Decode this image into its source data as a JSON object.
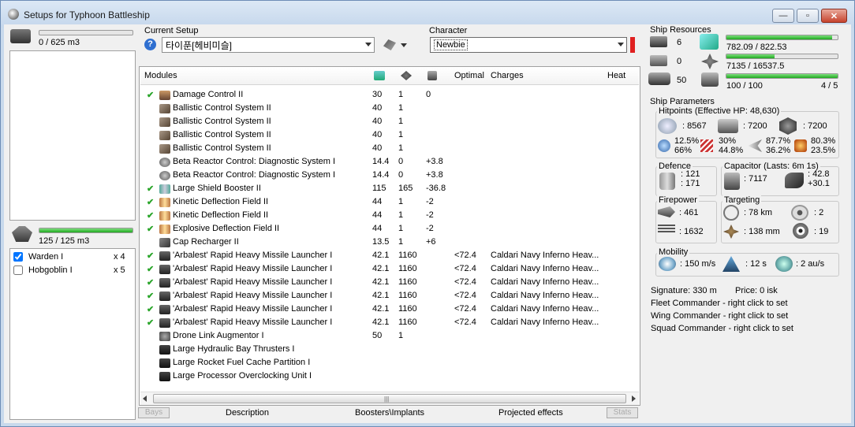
{
  "window": {
    "title": "Setups for Typhoon Battleship",
    "minimize": "—",
    "maximize": "▫",
    "close": "✕"
  },
  "cargo": {
    "text": "0 / 625 m3",
    "fraction": 0.0
  },
  "drones": {
    "bandwidth_text": "125 / 125 m3",
    "fraction": 1.0,
    "items": [
      {
        "name": "Warden I",
        "qty": "x 4",
        "checked": true
      },
      {
        "name": "Hobgoblin I",
        "qty": "x 5",
        "checked": false
      }
    ]
  },
  "setup": {
    "label": "Current Setup",
    "value": "타이푼[헤비미슬]"
  },
  "character": {
    "label": "Character",
    "value": "Newbie"
  },
  "modules": {
    "headers": {
      "name": "Modules",
      "optimal": "Optimal",
      "charges": "Charges",
      "heat": "Heat"
    },
    "rows": [
      {
        "check": true,
        "name": "Damage Control II",
        "cpu": "30",
        "pg": "1",
        "cap": "0",
        "optimal": "",
        "charges": "",
        "icon": "damage-control-icon"
      },
      {
        "check": false,
        "name": "Ballistic Control System II",
        "cpu": "40",
        "pg": "1",
        "cap": "",
        "optimal": "",
        "charges": "",
        "icon": "ballistic-control-icon"
      },
      {
        "check": false,
        "name": "Ballistic Control System II",
        "cpu": "40",
        "pg": "1",
        "cap": "",
        "optimal": "",
        "charges": "",
        "icon": "ballistic-control-icon"
      },
      {
        "check": false,
        "name": "Ballistic Control System II",
        "cpu": "40",
        "pg": "1",
        "cap": "",
        "optimal": "",
        "charges": "",
        "icon": "ballistic-control-icon"
      },
      {
        "check": false,
        "name": "Ballistic Control System II",
        "cpu": "40",
        "pg": "1",
        "cap": "",
        "optimal": "",
        "charges": "",
        "icon": "ballistic-control-icon"
      },
      {
        "check": false,
        "name": "Beta Reactor Control: Diagnostic System I",
        "cpu": "14.4",
        "pg": "0",
        "cap": "+3.8",
        "optimal": "",
        "charges": "",
        "icon": "reactor-control-icon"
      },
      {
        "check": false,
        "name": "Beta Reactor Control: Diagnostic System I",
        "cpu": "14.4",
        "pg": "0",
        "cap": "+3.8",
        "optimal": "",
        "charges": "",
        "icon": "reactor-control-icon"
      },
      {
        "check": true,
        "name": "Large Shield Booster II",
        "cpu": "115",
        "pg": "165",
        "cap": "-36.8",
        "optimal": "",
        "charges": "",
        "icon": "shield-booster-icon"
      },
      {
        "check": true,
        "name": "Kinetic Deflection Field II",
        "cpu": "44",
        "pg": "1",
        "cap": "-2",
        "optimal": "",
        "charges": "",
        "icon": "deflection-field-icon"
      },
      {
        "check": true,
        "name": "Kinetic Deflection Field II",
        "cpu": "44",
        "pg": "1",
        "cap": "-2",
        "optimal": "",
        "charges": "",
        "icon": "deflection-field-icon"
      },
      {
        "check": true,
        "name": "Explosive Deflection Field II",
        "cpu": "44",
        "pg": "1",
        "cap": "-2",
        "optimal": "",
        "charges": "",
        "icon": "deflection-field-icon"
      },
      {
        "check": false,
        "name": "Cap Recharger II",
        "cpu": "13.5",
        "pg": "1",
        "cap": "+6",
        "optimal": "",
        "charges": "",
        "icon": "cap-recharger-icon"
      },
      {
        "check": true,
        "name": "'Arbalest' Rapid Heavy Missile Launcher I",
        "cpu": "42.1",
        "pg": "1160",
        "cap": "",
        "optimal": "<72.4",
        "charges": "Caldari Navy Inferno Heav...",
        "icon": "missile-launcher-icon"
      },
      {
        "check": true,
        "name": "'Arbalest' Rapid Heavy Missile Launcher I",
        "cpu": "42.1",
        "pg": "1160",
        "cap": "",
        "optimal": "<72.4",
        "charges": "Caldari Navy Inferno Heav...",
        "icon": "missile-launcher-icon"
      },
      {
        "check": true,
        "name": "'Arbalest' Rapid Heavy Missile Launcher I",
        "cpu": "42.1",
        "pg": "1160",
        "cap": "",
        "optimal": "<72.4",
        "charges": "Caldari Navy Inferno Heav...",
        "icon": "missile-launcher-icon"
      },
      {
        "check": true,
        "name": "'Arbalest' Rapid Heavy Missile Launcher I",
        "cpu": "42.1",
        "pg": "1160",
        "cap": "",
        "optimal": "<72.4",
        "charges": "Caldari Navy Inferno Heav...",
        "icon": "missile-launcher-icon"
      },
      {
        "check": true,
        "name": "'Arbalest' Rapid Heavy Missile Launcher I",
        "cpu": "42.1",
        "pg": "1160",
        "cap": "",
        "optimal": "<72.4",
        "charges": "Caldari Navy Inferno Heav...",
        "icon": "missile-launcher-icon"
      },
      {
        "check": true,
        "name": "'Arbalest' Rapid Heavy Missile Launcher I",
        "cpu": "42.1",
        "pg": "1160",
        "cap": "",
        "optimal": "<72.4",
        "charges": "Caldari Navy Inferno Heav...",
        "icon": "missile-launcher-icon"
      },
      {
        "check": false,
        "name": "Drone Link Augmentor I",
        "cpu": "50",
        "pg": "1",
        "cap": "",
        "optimal": "",
        "charges": "",
        "icon": "drone-link-icon"
      },
      {
        "check": false,
        "name": "Large Hydraulic Bay Thrusters I",
        "cpu": "",
        "pg": "",
        "cap": "",
        "optimal": "",
        "charges": "",
        "icon": "rig-icon"
      },
      {
        "check": false,
        "name": "Large Rocket Fuel Cache Partition I",
        "cpu": "",
        "pg": "",
        "cap": "",
        "optimal": "",
        "charges": "",
        "icon": "rig-icon"
      },
      {
        "check": false,
        "name": "Large Processor Overclocking Unit I",
        "cpu": "",
        "pg": "",
        "cap": "",
        "optimal": "",
        "charges": "",
        "icon": "rig-icon"
      }
    ]
  },
  "bottom_tabs": {
    "bays": "Bays",
    "description": "Description",
    "boosters": "Boosters\\Implants",
    "projected": "Projected effects",
    "stats": "Stats"
  },
  "resources": {
    "title": "Ship Resources",
    "high_slots": "6",
    "mid_slots": "0",
    "low_slots": "50",
    "cpu_text": "782.09 / 822.53",
    "cpu_fraction": 0.95,
    "pg_text": "7135 / 16537.5",
    "pg_fraction": 0.43,
    "calib_text": "100 / 100",
    "calib_fraction": 1.0,
    "turret_text": "4 / 5"
  },
  "params": {
    "title": "Ship Parameters",
    "hitpoints_label": "Hitpoints (Effective HP: 48,630)",
    "shield_hp": ": 8567",
    "armor_hp": ": 7200",
    "structure_hp": ": 7200",
    "shield_res": [
      "12.5%",
      "66%"
    ],
    "armor_res": [
      "30%",
      "44.8%"
    ],
    "structure_res": [
      "87.7%",
      "36.2%"
    ],
    "hull_res": [
      "80.3%",
      "23.5%"
    ],
    "defence_label": "Defence",
    "defence_a": ": 121",
    "defence_b": ": 171",
    "capacitor_label": "Capacitor (Lasts: 6m 1s)",
    "capacitor_value": ": 7117",
    "capacitor_a": ": 42.8",
    "capacitor_b": "+30.1",
    "firepower_label": "Firepower",
    "firepower_a": ": 461",
    "firepower_b": ": 1632",
    "targeting_label": "Targeting",
    "targeting_range": ": 78 km",
    "targeting_count": ": 2",
    "targeting_res": ": 138 mm",
    "targeting_sensor": ": 19",
    "mobility_label": "Mobility",
    "speed": ": 150 m/s",
    "align": ": 12 s",
    "warp": ": 2 au/s",
    "signature": "Signature: 330 m",
    "price": "Price: 0 isk",
    "fleet": "Fleet Commander - right click to set",
    "wing": "Wing Commander - right click to set",
    "squad": "Squad Commander - right click to set"
  }
}
